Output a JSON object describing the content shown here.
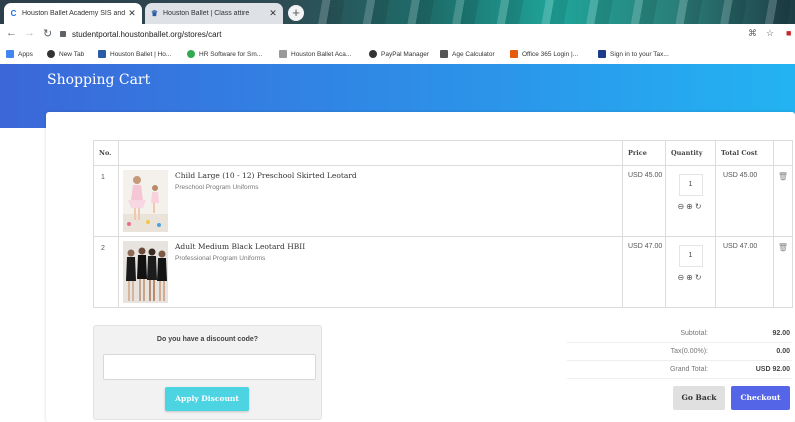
{
  "browser": {
    "tabs": [
      {
        "title": "Houston Ballet Academy SIS and",
        "favicon": "C",
        "active": true
      },
      {
        "title": "Houston Ballet | Class attire",
        "favicon": "hb-icon",
        "active": false
      }
    ],
    "url": "studentportal.houstonballet.org/stores/cart",
    "bookmarks": [
      {
        "label": "Apps",
        "icon": "apps-grid-icon"
      },
      {
        "label": "New Tab",
        "icon": "globe-icon"
      },
      {
        "label": "Houston Ballet | Ho...",
        "icon": "hb-icon"
      },
      {
        "label": "HR Software for Sm...",
        "icon": "green-circle-icon"
      },
      {
        "label": "Houston Ballet Aca...",
        "icon": "hb-crest-icon"
      },
      {
        "label": "PayPal Manager",
        "icon": "globe-icon"
      },
      {
        "label": "Age Calculator",
        "icon": "calculator-icon"
      },
      {
        "label": "Office 365 Login |...",
        "icon": "office-icon"
      },
      {
        "label": "Sign in to your Tax...",
        "icon": "tax-icon"
      }
    ]
  },
  "page": {
    "title": "Shopping Cart",
    "columns": {
      "no": "No.",
      "price": "Price",
      "quantity": "Quantity",
      "total": "Total Cost"
    },
    "items": [
      {
        "no": "1",
        "name": "Child Large (10 - 12) Preschool Skirted Leotard",
        "category": "Preschool Program Uniforms",
        "price": "USD 45.00",
        "quantity": "1",
        "total": "USD 45.00"
      },
      {
        "no": "2",
        "name": "Adult Medium Black Leotard HBII",
        "category": "Professional Program Uniforms",
        "price": "USD 47.00",
        "quantity": "1",
        "total": "USD 47.00"
      }
    ],
    "discount": {
      "prompt": "Do you have a discount code?",
      "input_value": "",
      "button": "Apply Discount"
    },
    "totals": {
      "subtotal_label": "Subtotal:",
      "subtotal": "92.00",
      "tax_label": "Tax(0.00%):",
      "tax": "0.00",
      "grand_label": "Grand Total:",
      "grand": "USD 92.00"
    },
    "actions": {
      "back": "Go Back",
      "checkout": "Checkout"
    }
  },
  "colors": {
    "banner_start": "#3b67d9",
    "banner_end": "#23b3f2",
    "checkout": "#5565e8",
    "apply": "#4dd4e2"
  }
}
